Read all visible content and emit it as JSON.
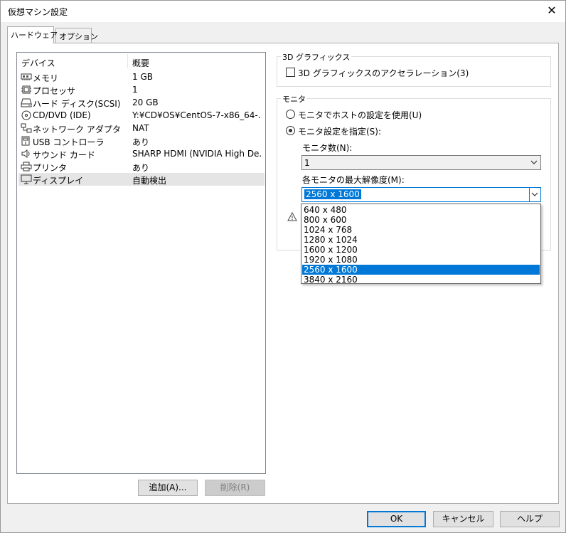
{
  "window": {
    "title": "仮想マシン設定",
    "close_glyph": "✕"
  },
  "tabs": [
    {
      "label": "ハードウェア",
      "active": true
    },
    {
      "label": "オプション",
      "active": false
    }
  ],
  "device_list": {
    "columns": [
      "デバイス",
      "概要"
    ],
    "rows": [
      {
        "icon": "memory-icon",
        "name": "メモリ",
        "value": "1 GB"
      },
      {
        "icon": "processor-icon",
        "name": "プロセッサ",
        "value": "1"
      },
      {
        "icon": "hard-disk-icon",
        "name": "ハード ディスク(SCSI)",
        "value": "20 GB"
      },
      {
        "icon": "cd-dvd-icon",
        "name": "CD/DVD (IDE)",
        "value": "Y:¥CD¥OS¥CentOS-7-x86_64-..."
      },
      {
        "icon": "network-icon",
        "name": "ネットワーク アダプタ",
        "value": "NAT"
      },
      {
        "icon": "usb-icon",
        "name": "USB コントローラ",
        "value": "あり"
      },
      {
        "icon": "sound-icon",
        "name": "サウンド カード",
        "value": "SHARP HDMI (NVIDIA High De..."
      },
      {
        "icon": "printer-icon",
        "name": "プリンタ",
        "value": "あり"
      },
      {
        "icon": "display-icon",
        "name": "ディスプレイ",
        "value": "自動検出",
        "selected": true
      }
    ]
  },
  "list_buttons": {
    "add": "追加(A)...",
    "remove": "削除(R)"
  },
  "graphics_3d": {
    "group_label": "3D グラフィックス",
    "accel_label": "3D グラフィックスのアクセラレーション(3)",
    "accel_checked": false
  },
  "monitor": {
    "group_label": "モニタ",
    "use_host_label": "モニタでホストの設定を使用(U)",
    "specify_label": "モニタ設定を指定(S):",
    "selected_option": "specify",
    "count_label": "モニタ数(N):",
    "count_value": "1",
    "max_res_label": "各モニタの最大解像度(M):",
    "max_res_value": "2560 x 1600",
    "resolution_options": [
      "640 x 480",
      "800 x 600",
      "1024 x 768",
      "1280 x 1024",
      "1600 x 1200",
      "1920 x 1080",
      "2560 x 1600",
      "3840 x 2160"
    ],
    "selected_resolution_index": 6
  },
  "footer": {
    "ok": "OK",
    "cancel": "キャンセル",
    "help": "ヘルプ"
  },
  "colors": {
    "accent": "#0078d7",
    "selected_row": "#e5e5e5",
    "border": "#adadad"
  }
}
